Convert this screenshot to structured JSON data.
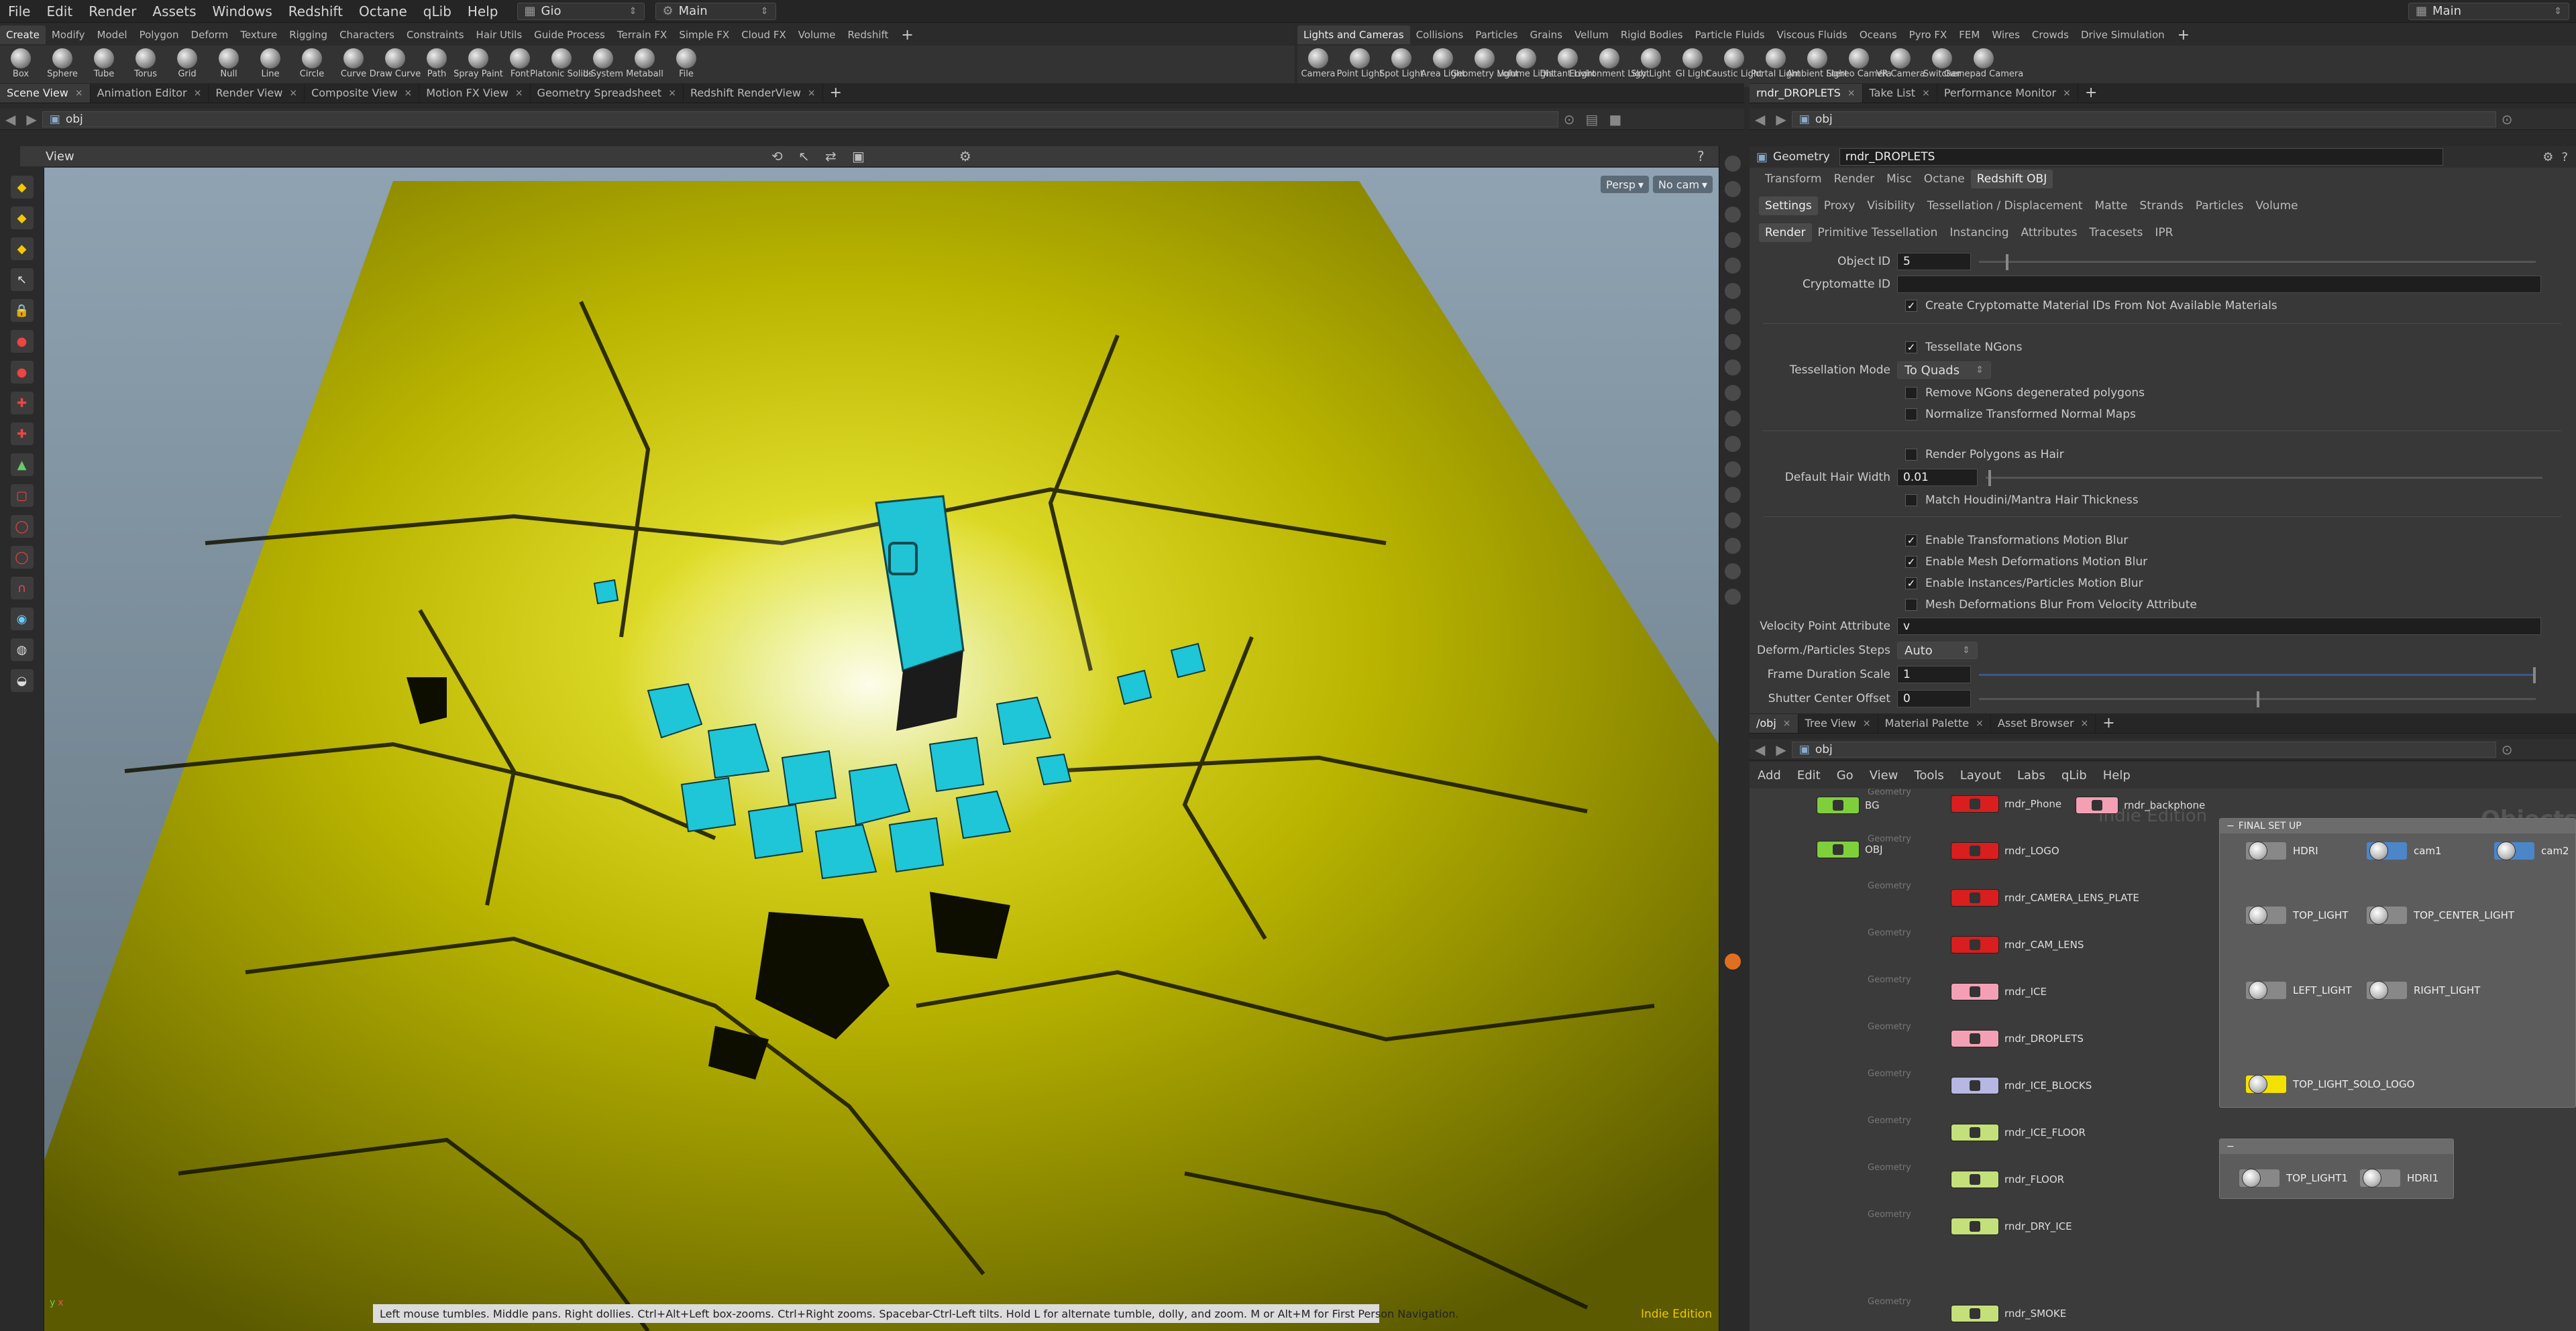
{
  "menu": {
    "items": [
      "File",
      "Edit",
      "Render",
      "Assets",
      "Windows",
      "Redshift",
      "Octane",
      "qLib",
      "Help"
    ],
    "desktop": "Gio",
    "context": "Main",
    "right_desktop": "Main"
  },
  "shelf_tabs_left": [
    "Create",
    "Modify",
    "Model",
    "Polygon",
    "Deform",
    "Texture",
    "Rigging",
    "Characters",
    "Constraints",
    "Hair Utils",
    "Guide Process",
    "Terrain FX",
    "Simple FX",
    "Cloud FX",
    "Volume",
    "Redshift"
  ],
  "shelf_tabs_right": [
    "Lights and Cameras",
    "Collisions",
    "Particles",
    "Grains",
    "Vellum",
    "Rigid Bodies",
    "Particle Fluids",
    "Viscous Fluids",
    "Oceans",
    "Pyro FX",
    "FEM",
    "Wires",
    "Crowds",
    "Drive Simulation"
  ],
  "shelf_tools_left": [
    "Box",
    "Sphere",
    "Tube",
    "Torus",
    "Grid",
    "Null",
    "Line",
    "Circle",
    "Curve",
    "Draw Curve",
    "Path",
    "Spray Paint",
    "Font",
    "Platonic Solids",
    "L-System",
    "Metaball",
    "File"
  ],
  "shelf_tools_right": [
    "Camera",
    "Point Light",
    "Spot Light",
    "Area Light",
    "Geometry Light",
    "Volume Light",
    "Distant Light",
    "Environment Light",
    "Sky Light",
    "GI Light",
    "Caustic Light",
    "Portal Light",
    "Ambient Light",
    "Stereo Camera",
    "VR Camera",
    "Switcher",
    "Gamepad Camera"
  ],
  "pane_tabs_left": [
    "Scene View",
    "Animation Editor",
    "Render View",
    "Composite View",
    "Motion FX View",
    "Geometry Spreadsheet",
    "Redshift RenderView"
  ],
  "pane_tabs_right": [
    "rndr_DROPLETS",
    "Take List",
    "Performance Monitor"
  ],
  "scene_path": "obj",
  "param_path": "obj",
  "viewer": {
    "title": "View",
    "persp": "Persp",
    "cam": "No cam"
  },
  "param": {
    "node_type": "Geometry",
    "node_name": "rndr_DROPLETS",
    "top_tabs": [
      "Transform",
      "Render",
      "Misc",
      "Octane",
      "Redshift OBJ"
    ],
    "sub_tabs": [
      "Settings",
      "Proxy",
      "Visibility",
      "Tessellation / Displacement",
      "Matte",
      "Strands",
      "Particles",
      "Volume"
    ],
    "sub_sub_tabs": [
      "Render",
      "Primitive Tessellation",
      "Instancing",
      "Attributes",
      "Tracesets",
      "IPR"
    ],
    "object_id_label": "Object ID",
    "object_id": "5",
    "crypto_label": "Cryptomatte ID",
    "crypto_mat": "Create Cryptomatte Material IDs From Not Available Materials",
    "tess_ngons": "Tessellate NGons",
    "tess_mode_label": "Tessellation Mode",
    "tess_mode": "To Quads",
    "remove_ngons": "Remove NGons degenerated polygons",
    "normalize": "Normalize Transformed Normal Maps",
    "render_hair": "Render Polygons as Hair",
    "hair_width_label": "Default Hair Width",
    "hair_width": "0.01",
    "match_hair": "Match Houdini/Mantra Hair Thickness",
    "mb_transform": "Enable Transformations Motion Blur",
    "mb_mesh": "Enable Mesh Deformations Motion Blur",
    "mb_inst": "Enable Instances/Particles Motion Blur",
    "mb_vel": "Mesh Deformations Blur From Velocity Attribute",
    "vel_label": "Velocity Point Attribute",
    "vel_value": "v",
    "steps_label": "Deform./Particles Steps",
    "steps_value": "Auto",
    "frame_label": "Frame Duration Scale",
    "frame_value": "1",
    "shutter_label": "Shutter Center Offset",
    "shutter_value": "0"
  },
  "network": {
    "tabs": [
      "/obj",
      "Tree View",
      "Material Palette",
      "Asset Browser"
    ],
    "path": "obj",
    "menu": [
      "Add",
      "Edit",
      "Go",
      "View",
      "Tools",
      "Layout",
      "Labs",
      "qLib",
      "Help"
    ],
    "watermark_edition": "Indie Edition",
    "watermark_context": "Objects",
    "node_type_label": "Geometry",
    "left_nodes": [
      {
        "name": "BG",
        "color": "#7fcf3a"
      },
      {
        "name": "OBJ",
        "color": "#7fcf3a"
      }
    ],
    "nodes": [
      {
        "name": "rndr_Phone",
        "color": "#d81e1e"
      },
      {
        "name": "rndr_LOGO",
        "color": "#d81e1e"
      },
      {
        "name": "rndr_CAMERA_LENS_PLATE",
        "color": "#d81e1e"
      },
      {
        "name": "rndr_CAM_LENS",
        "color": "#d81e1e"
      },
      {
        "name": "rndr_ICE",
        "color": "#f4a0b4"
      },
      {
        "name": "rndr_DROPLETS",
        "color": "#f4a0b4"
      },
      {
        "name": "rndr_ICE_BLOCKS",
        "color": "#b7b7e3"
      },
      {
        "name": "rndr_ICE_FLOOR",
        "color": "#c4e07a"
      },
      {
        "name": "rndr_FLOOR",
        "color": "#c4e07a"
      },
      {
        "name": "rndr_DRY_ICE",
        "color": "#c4e07a"
      },
      {
        "name": "rndr_SMOKE",
        "color": "#c4e07a"
      }
    ],
    "backphone": {
      "name": "rndr_backphone",
      "color": "#f4a0b4"
    },
    "box1_title": "FINAL SET UP",
    "lights": [
      "HDRI",
      "cam1",
      "cam2",
      "TOP_LIGHT",
      "TOP_CENTER_LIGHT",
      "LEFT_LIGHT",
      "RIGHT_LIGHT",
      "TOP_LIGHT_SOLO_LOGO"
    ],
    "box2_lights": [
      "TOP_LIGHT1",
      "HDRI1"
    ]
  },
  "status": "Left mouse tumbles. Middle pans. Right dollies. Ctrl+Alt+Left box-zooms. Ctrl+Right zooms. Spacebar-Ctrl-Left tilts. Hold L for alternate tumble, dolly, and zoom.     M or Alt+M for First Person Navigation.",
  "edition": "Indie Edition",
  "colors": {
    "floor": "#c9c400",
    "ice": "#22c8d8",
    "accent": "#f3c800"
  }
}
